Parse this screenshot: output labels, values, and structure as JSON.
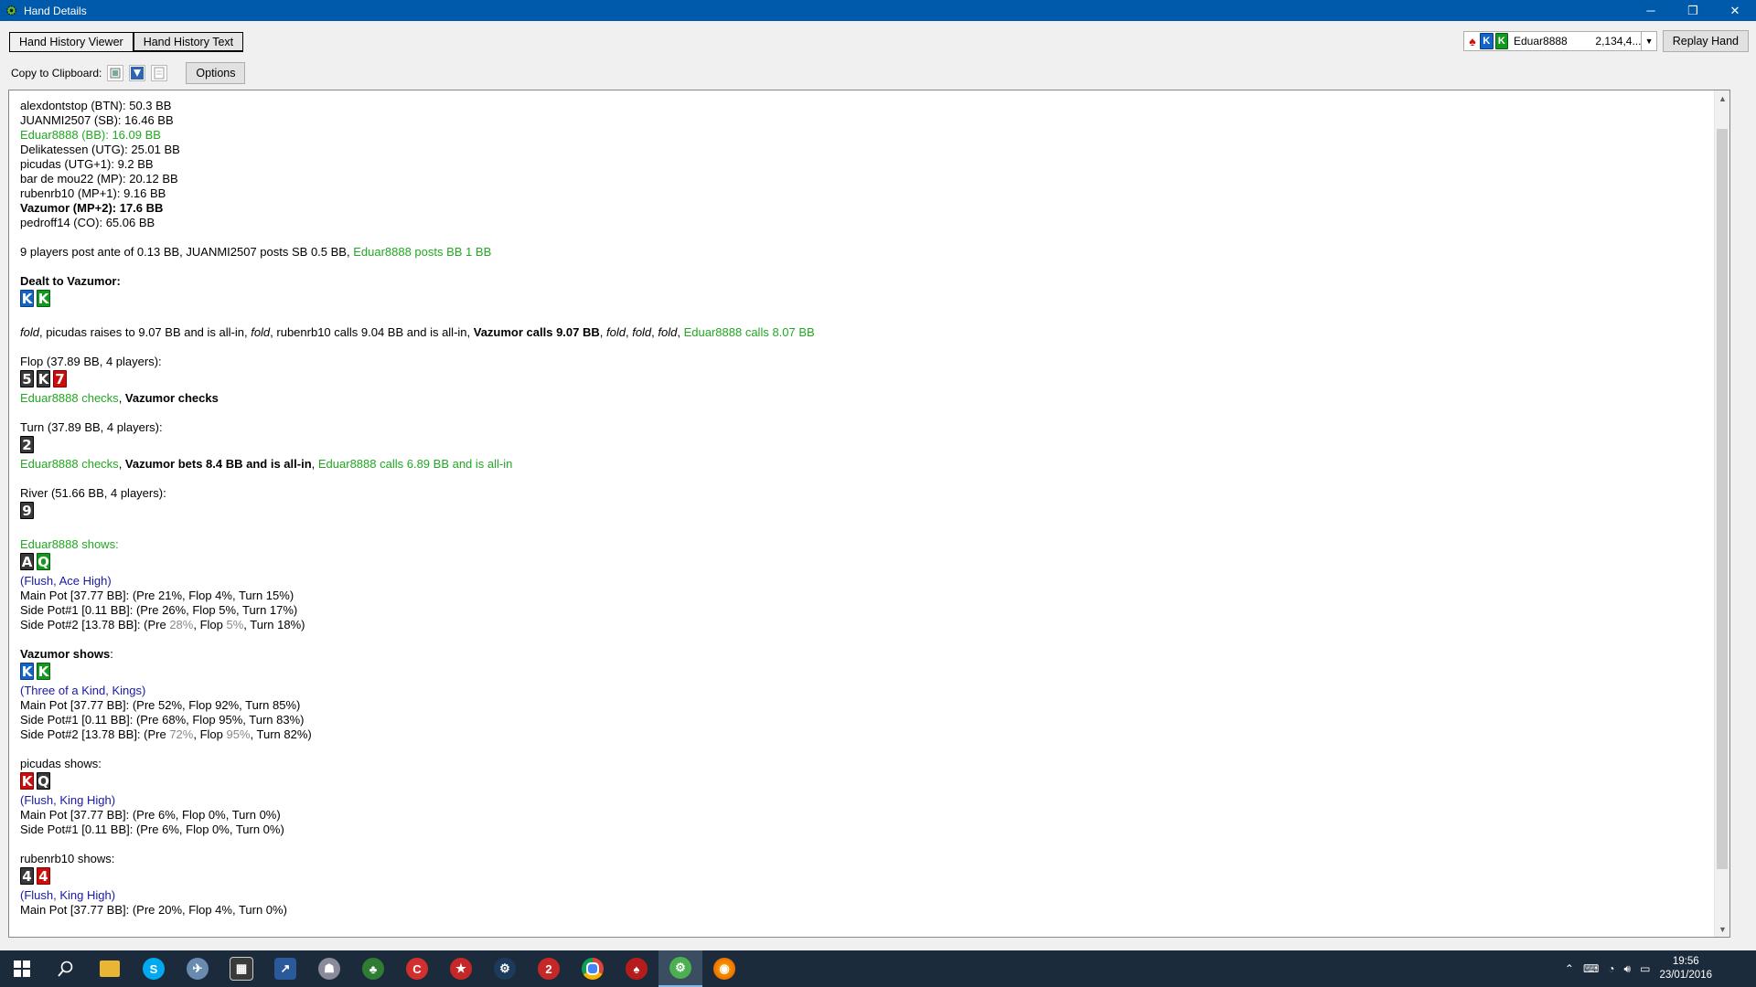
{
  "window": {
    "title": "Hand Details",
    "minimize": "─",
    "maximize": "❐",
    "close": "✕"
  },
  "tabs": [
    "Hand History Viewer",
    "Hand History Text"
  ],
  "player_select": {
    "name": "Eduar8888",
    "value": "2,134,4..."
  },
  "replay_label": "Replay Hand",
  "clipboard_label": "Copy to Clipboard:",
  "options_label": "Options",
  "colors": {
    "title_bar": "#005aab",
    "green": "#22a822",
    "blue": "#1818a8",
    "spade": "#3a3a3a",
    "heart": "#cc0d0d",
    "diamond": "#1366c8",
    "club": "#119a1d"
  },
  "players": [
    {
      "text": "alexdontstop (BTN): 50.3 BB"
    },
    {
      "text": "JUANMI2507 (SB): 16.46 BB"
    },
    {
      "text": "Eduar8888 (BB): 16.09 BB"
    },
    {
      "text": "Delikatessen (UTG): 25.01 BB"
    },
    {
      "text": "picudas (UTG+1): 9.2 BB"
    },
    {
      "text": "bar de mou22 (MP): 20.12 BB"
    },
    {
      "text": "rubenrb10 (MP+1): 9.16 BB"
    },
    {
      "text": "Vazumor (MP+2): 17.6 BB"
    },
    {
      "text": "pedroff14 (CO): 65.06 BB"
    }
  ],
  "antes": {
    "main": "9 players post ante of 0.13 BB, JUANMI2507 posts SB 0.5 BB, ",
    "hero": "Eduar8888 posts BB 1 BB"
  },
  "dealt": {
    "label": "Dealt to Vazumor:",
    "cards": [
      "K",
      "K"
    ]
  },
  "preflop": {
    "f1": "fold",
    "t1": ", picudas raises to 9.07 BB and is all-in, ",
    "f2": "fold",
    "t2": ", rubenrb10 calls 9.04 BB and is all-in, ",
    "vaz": "Vazumor calls 9.07 BB",
    "sep1": ", ",
    "f3": "fold",
    "sep2": ", ",
    "f4": "fold",
    "sep3": ", ",
    "f5": "fold",
    "sep4": ", ",
    "edu": "Eduar8888 calls 8.07 BB"
  },
  "flop": {
    "label": "Flop (37.89 BB, 4 players):",
    "cards": [
      "5",
      "K",
      "7"
    ],
    "a1": "Eduar8888 checks",
    "sep": ", ",
    "a2": "Vazumor checks"
  },
  "turn": {
    "label": "Turn (37.89 BB, 4 players):",
    "cards": [
      "2"
    ],
    "a1": "Eduar8888 checks",
    "sep1": ", ",
    "a2": "Vazumor bets 8.4 BB and is all-in",
    "sep2": ", ",
    "a3": "Eduar8888 calls 6.89 BB and is all-in"
  },
  "river": {
    "label": "River (51.66 BB, 4 players):",
    "cards": [
      "9"
    ]
  },
  "showdowns": [
    {
      "player": "Eduar8888 shows:",
      "cards": [
        "A",
        "Q"
      ],
      "hand": "(Flush, Ace High)",
      "mp": "Main Pot [37.77 BB]: (Pre 21%, Flop 4%, Turn 15%)",
      "sp1": "Side Pot#1 [0.11 BB]: (Pre 26%, Flop 5%, Turn 17%)",
      "sp2a": "Side Pot#2 [13.78 BB]: (Pre ",
      "sp2b": "28%",
      "sp2c": ", Flop ",
      "sp2d": "5%",
      "sp2e": ", Turn 18%)"
    },
    {
      "player": "Vazumor shows",
      "colon": ":",
      "cards": [
        "K",
        "K"
      ],
      "hand": "(Three of a Kind, Kings)",
      "mp": "Main Pot [37.77 BB]: (Pre 52%, Flop 92%, Turn 85%)",
      "sp1": "Side Pot#1 [0.11 BB]: (Pre 68%, Flop 95%, Turn 83%)",
      "sp2a": "Side Pot#2 [13.78 BB]: (Pre ",
      "sp2b": "72%",
      "sp2c": ", Flop ",
      "sp2d": "95%",
      "sp2e": ", Turn 82%)"
    },
    {
      "player": "picudas shows:",
      "cards": [
        "K",
        "Q"
      ],
      "hand": "(Flush, King High)",
      "mp": "Main Pot [37.77 BB]: (Pre 6%, Flop 0%, Turn 0%)",
      "sp1": "Side Pot#1 [0.11 BB]: (Pre 6%, Flop 0%, Turn 0%)"
    },
    {
      "player": "rubenrb10 shows:",
      "cards": [
        "4",
        "4"
      ],
      "hand": "(Flush, King High)",
      "mp": "Main Pot [37.77 BB]: (Pre 20%, Flop 4%, Turn 0%)"
    }
  ],
  "clock": {
    "time": "19:56",
    "date": "23/01/2016"
  }
}
